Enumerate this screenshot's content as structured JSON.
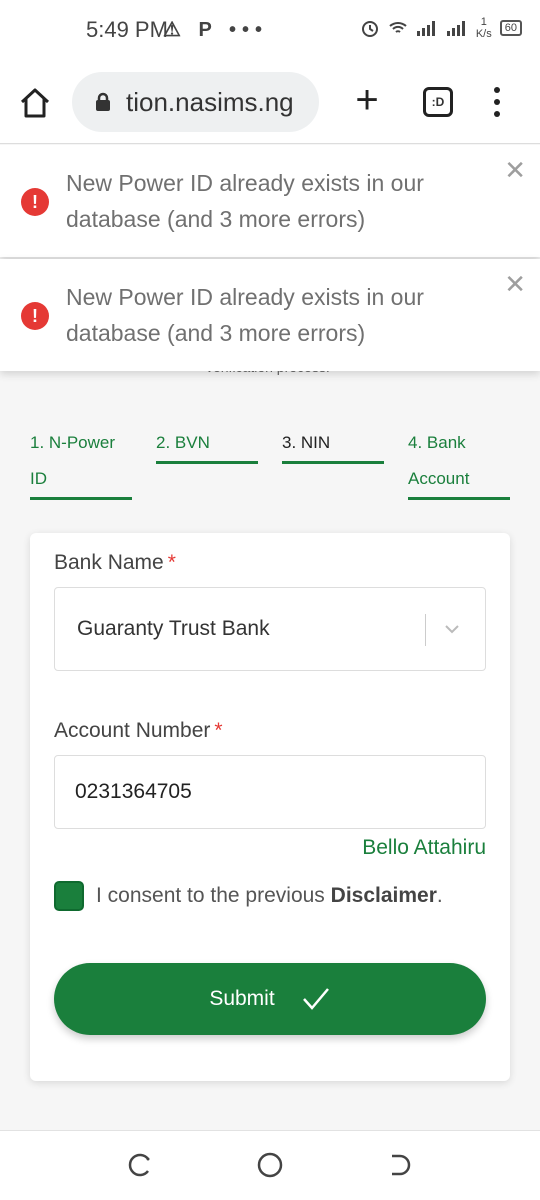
{
  "status_bar": {
    "time": "5:49 PM",
    "left_icons": "⚠ P •••",
    "net_speed_value": "1",
    "net_speed_unit": "K/s",
    "battery": "60"
  },
  "browser": {
    "url": "tion.nasims.ng",
    "tabs_label": ":D"
  },
  "toasts": [
    {
      "message": "New Power ID already exists in our database (and 3 more errors)"
    },
    {
      "message": "New Power ID already exists in our database (and 3 more errors)"
    }
  ],
  "partial_text": "verification process.",
  "steps": [
    {
      "label": "1. N-Power ID"
    },
    {
      "label": "2. BVN"
    },
    {
      "label": "3. NIN"
    },
    {
      "label": "4. Bank Account"
    }
  ],
  "form": {
    "bank_label": "Bank Name",
    "bank_value": "Guaranty Trust Bank",
    "account_label": "Account Number",
    "account_value": "0231364705",
    "account_name": "Bello Attahiru",
    "required_mark": "*",
    "consent_prefix": "I consent to the previous",
    "consent_bold": "Disclaimer",
    "consent_suffix": ".",
    "consent_checked": true,
    "submit_label": "Submit"
  },
  "colors": {
    "accent": "#1a7f3c",
    "error": "#e53935"
  }
}
